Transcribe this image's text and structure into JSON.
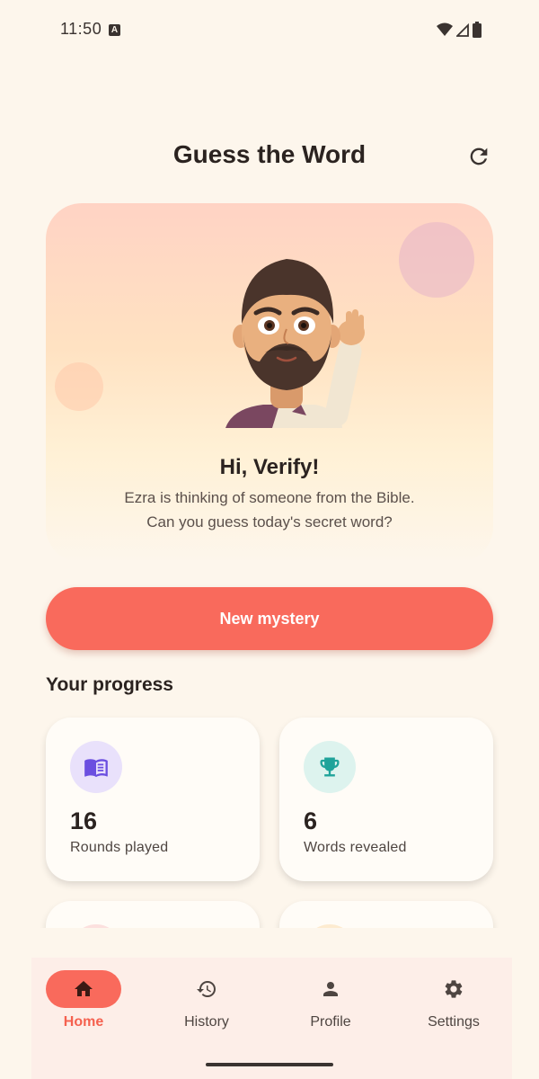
{
  "status_bar": {
    "time": "11:50",
    "notification_icon": "a-icon"
  },
  "header": {
    "title": "Guess the Word",
    "refresh_icon": "refresh-icon"
  },
  "hero": {
    "greeting": "Hi, Verify!",
    "description_line1": "Ezra is thinking of someone from the Bible.",
    "description_line2": "Can you guess today's secret word?",
    "avatar": "waving-character-avatar"
  },
  "primary_action": {
    "label": "New mystery"
  },
  "progress": {
    "title": "Your progress",
    "stats": [
      {
        "value": "16",
        "label": "Rounds played",
        "icon": "book-icon",
        "icon_color": "#6B4FE0",
        "bg_color": "#E9E1FB"
      },
      {
        "value": "6",
        "label": "Words revealed",
        "icon": "trophy-icon",
        "icon_color": "#1FA39A",
        "bg_color": "#DDF3EE"
      }
    ]
  },
  "bottom_nav": {
    "items": [
      {
        "label": "Home",
        "icon": "home-icon",
        "active": true
      },
      {
        "label": "History",
        "icon": "history-icon",
        "active": false
      },
      {
        "label": "Profile",
        "icon": "person-icon",
        "active": false
      },
      {
        "label": "Settings",
        "icon": "gear-icon",
        "active": false
      }
    ]
  },
  "colors": {
    "background": "#FDF6EC",
    "accent": "#F96A5C",
    "nav_background": "#FDEEE8"
  }
}
